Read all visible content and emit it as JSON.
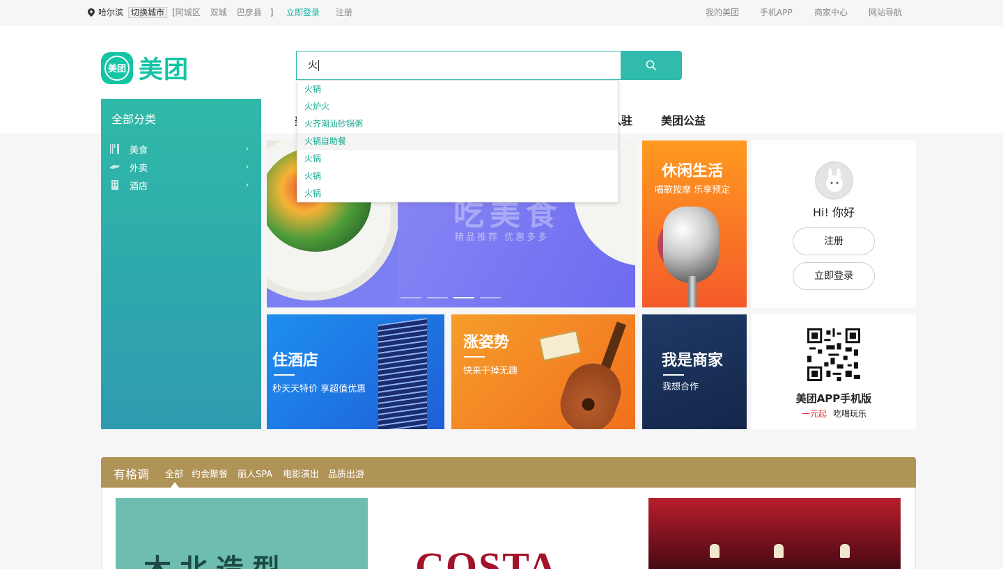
{
  "topbar": {
    "city": "哈尔滨",
    "switch_city": "切换城市",
    "bracket_open": "[",
    "bracket_close": "]",
    "nearby_cities": [
      "阿城区",
      "双城",
      "巴彦县"
    ],
    "login": "立即登录",
    "register": "注册",
    "right_links": [
      "我的美团",
      "手机APP",
      "商家中心",
      "网站导航"
    ]
  },
  "header": {
    "logo_badge": "美团",
    "logo_text": "美团",
    "search_value": "火",
    "nav": [
      "美",
      "入驻",
      "美团公益"
    ]
  },
  "suggestions": {
    "items": [
      "火锅",
      "火炉火",
      "火齐潮汕砂锅粥",
      "火锅自助餐",
      "火锅",
      "火锅",
      "火锅"
    ],
    "hover_index": 3
  },
  "sidebar": {
    "title": "全部分类",
    "items": [
      {
        "label": "美食",
        "icon": "utensils-icon"
      },
      {
        "label": "外卖",
        "icon": "delivery-icon"
      },
      {
        "label": "酒店",
        "icon": "building-icon"
      }
    ]
  },
  "banner": {
    "big_text": "吃美食",
    "sub_text": "精品推荐  优惠多多",
    "slides": 4,
    "active_slide": 2
  },
  "tiles": {
    "leisure": {
      "title": "休闲生活",
      "sub": "唱歌按摩 乐享预定"
    },
    "hotel": {
      "title": "住酒店",
      "sub": "秒天天特价 享超值优惠"
    },
    "trend": {
      "title": "涨姿势",
      "sub": "快来干掉无趣"
    },
    "merchant": {
      "title": "我是商家",
      "sub": "我想合作"
    }
  },
  "user_card": {
    "greeting": "Hi! 你好",
    "register": "注册",
    "login": "立即登录"
  },
  "app_card": {
    "title": "美团APP手机版",
    "promo": "一元起",
    "slogan": "吃喝玩乐"
  },
  "section": {
    "title": "有格调",
    "tabs": [
      "全部",
      "约会聚餐",
      "丽人SPA",
      "电影演出",
      "品质出游"
    ],
    "active_tab": 0,
    "cards": [
      "木北造型",
      "COSTA",
      ""
    ]
  },
  "colors": {
    "brand": "#13c4a5",
    "search": "#31bbac",
    "section_bar": "#b09356",
    "promo_red": "#e4393c"
  }
}
